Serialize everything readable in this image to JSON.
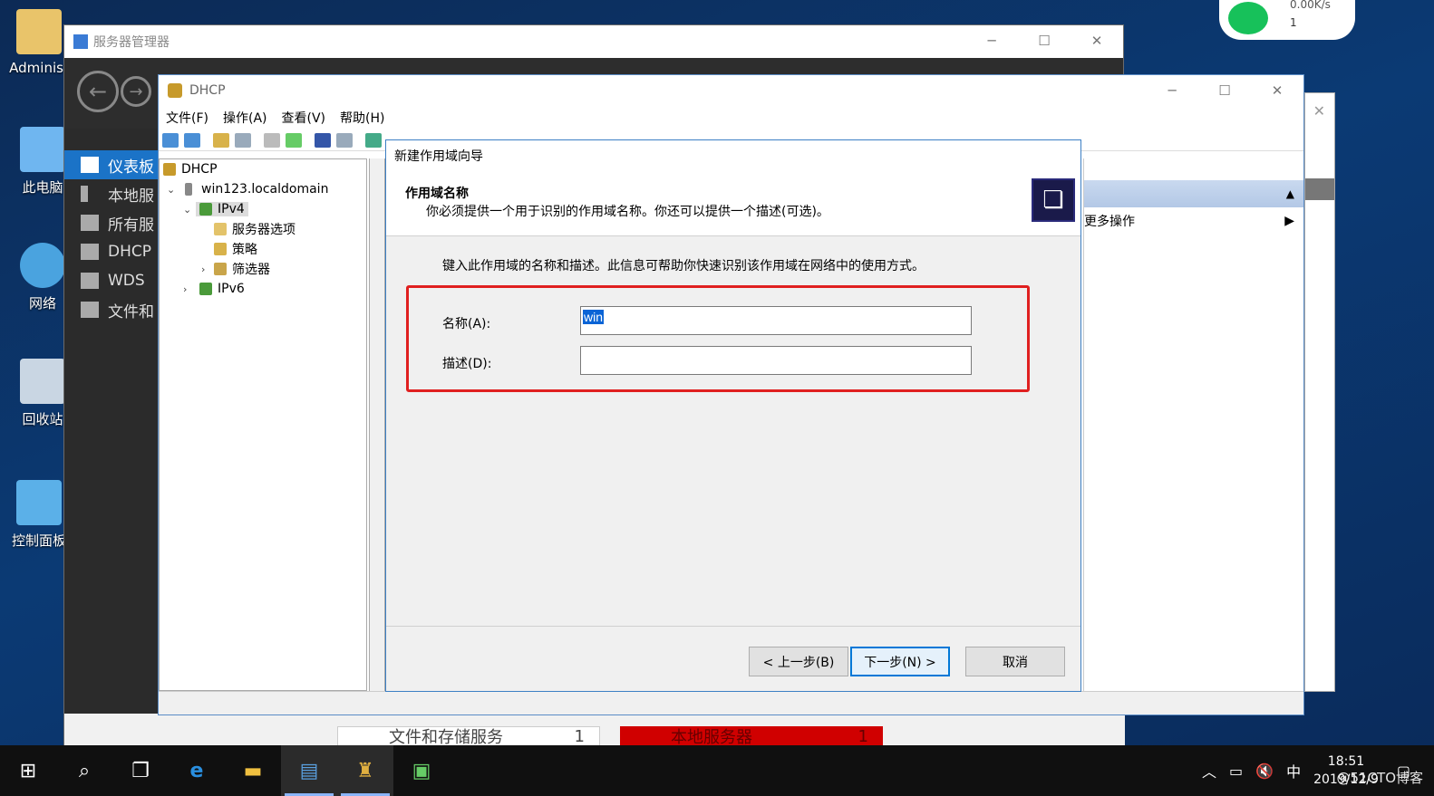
{
  "desktop": {
    "icons": [
      {
        "label": "Administ"
      },
      {
        "label": "此电脑"
      },
      {
        "label": "网络"
      },
      {
        "label": "回收站"
      },
      {
        "label": "控制面板"
      }
    ]
  },
  "wifi_widget": {
    "speed": "0.00K/s",
    "count": "1"
  },
  "server_manager": {
    "title": "服务器管理器",
    "sidebar": [
      {
        "label": "仪表板"
      },
      {
        "label": "本地服"
      },
      {
        "label": "所有服"
      },
      {
        "label": "DHCP"
      },
      {
        "label": "WDS"
      },
      {
        "label": "文件和"
      }
    ],
    "tiles": [
      {
        "label": "文件和存储服务",
        "count": "1"
      },
      {
        "label": "本地服务器",
        "count": "1"
      }
    ]
  },
  "dhcp": {
    "title": "DHCP",
    "menu": [
      "文件(F)",
      "操作(A)",
      "查看(V)",
      "帮助(H)"
    ],
    "tree": {
      "root": "DHCP",
      "server": "win123.localdomain",
      "ipv4": "IPv4",
      "ipv4_children": [
        "服务器选项",
        "策略",
        "筛选器"
      ],
      "ipv6": "IPv6"
    },
    "actions": {
      "more": "更多操作"
    }
  },
  "wizard": {
    "title": "新建作用域向导",
    "heading": "作用域名称",
    "subheading": "你必须提供一个用于识别的作用域名称。你还可以提供一个描述(可选)。",
    "intro": "键入此作用域的名称和描述。此信息可帮助你快速识别该作用域在网络中的使用方式。",
    "name_label": "名称(A):",
    "name_value": "win",
    "desc_label": "描述(D):",
    "desc_value": "",
    "back_button": "< 上一步(B)",
    "next_button": "下一步(N) >",
    "cancel_button": "取消"
  },
  "taskbar": {
    "tray_ime": "中",
    "time": "18:51",
    "date": "2019/12/9"
  },
  "watermark": "@51CTO博客"
}
